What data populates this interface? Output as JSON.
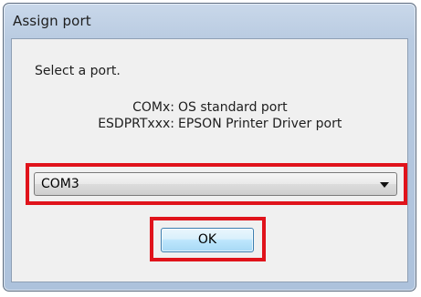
{
  "window": {
    "title": "Assign port"
  },
  "dialog": {
    "prompt": "Select a port.",
    "legend": [
      {
        "key": "COMx:",
        "description": "OS standard port"
      },
      {
        "key": "ESDPRTxxx:",
        "description": "EPSON Printer Driver port"
      }
    ],
    "port_select": {
      "selected_value": "COM3"
    },
    "ok_label": "OK"
  },
  "colors": {
    "highlight": "#e0131b",
    "titlebar": "#b9cbe1",
    "client_background": "#f0f0f0",
    "button_accent": "#3c7fb1"
  }
}
